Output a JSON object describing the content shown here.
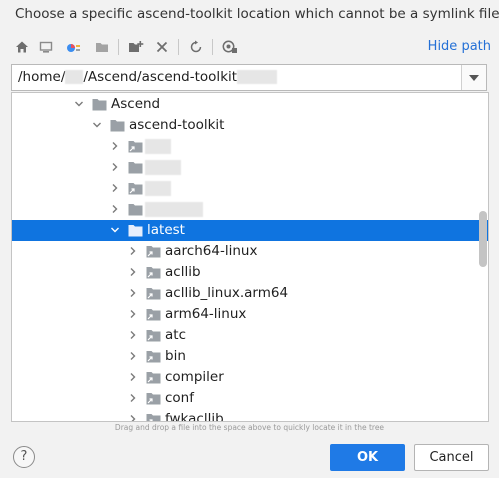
{
  "dialog": {
    "title": "Choose a specific ascend-toolkit location which cannot be a symlink file"
  },
  "toolbar": {
    "hide_path_label": "Hide path",
    "icons": [
      "home-icon",
      "desktop-icon",
      "project-icon",
      "module-icon",
      "new-folder-icon",
      "delete-icon",
      "refresh-icon",
      "show-hidden-icon"
    ]
  },
  "path": {
    "prefix": "/home/",
    "middle": "/Ascend/ascend-toolkit"
  },
  "tree": {
    "rows": [
      {
        "label": "Ascend",
        "expanded": true,
        "symlink": false
      },
      {
        "label": "ascend-toolkit",
        "expanded": true,
        "symlink": false
      },
      {
        "label": "",
        "expanded": false,
        "symlink": true
      },
      {
        "label": "",
        "expanded": false,
        "symlink": false
      },
      {
        "label": "",
        "expanded": false,
        "symlink": true
      },
      {
        "label": "",
        "expanded": false,
        "symlink": false
      },
      {
        "label": "latest",
        "expanded": true,
        "symlink": false,
        "selected": true
      },
      {
        "label": "aarch64-linux",
        "expanded": false,
        "symlink": true
      },
      {
        "label": "acllib",
        "expanded": false,
        "symlink": true
      },
      {
        "label": "acllib_linux.arm64",
        "expanded": false,
        "symlink": true
      },
      {
        "label": "arm64-linux",
        "expanded": false,
        "symlink": true
      },
      {
        "label": "atc",
        "expanded": false,
        "symlink": true
      },
      {
        "label": "bin",
        "expanded": false,
        "symlink": true
      },
      {
        "label": "compiler",
        "expanded": false,
        "symlink": true
      },
      {
        "label": "conf",
        "expanded": false,
        "symlink": true
      },
      {
        "label": "fwkacllib",
        "expanded": false,
        "symlink": true
      }
    ]
  },
  "hint": "Drag and drop a file into the space above to quickly locate it in the tree",
  "buttons": {
    "help_label": "?",
    "ok_label": "OK",
    "cancel_label": "Cancel"
  },
  "colors": {
    "selection": "#0f74e0",
    "link": "#2470d6",
    "ok_button": "#1f7ae6",
    "folder": "#9aa0a6"
  }
}
